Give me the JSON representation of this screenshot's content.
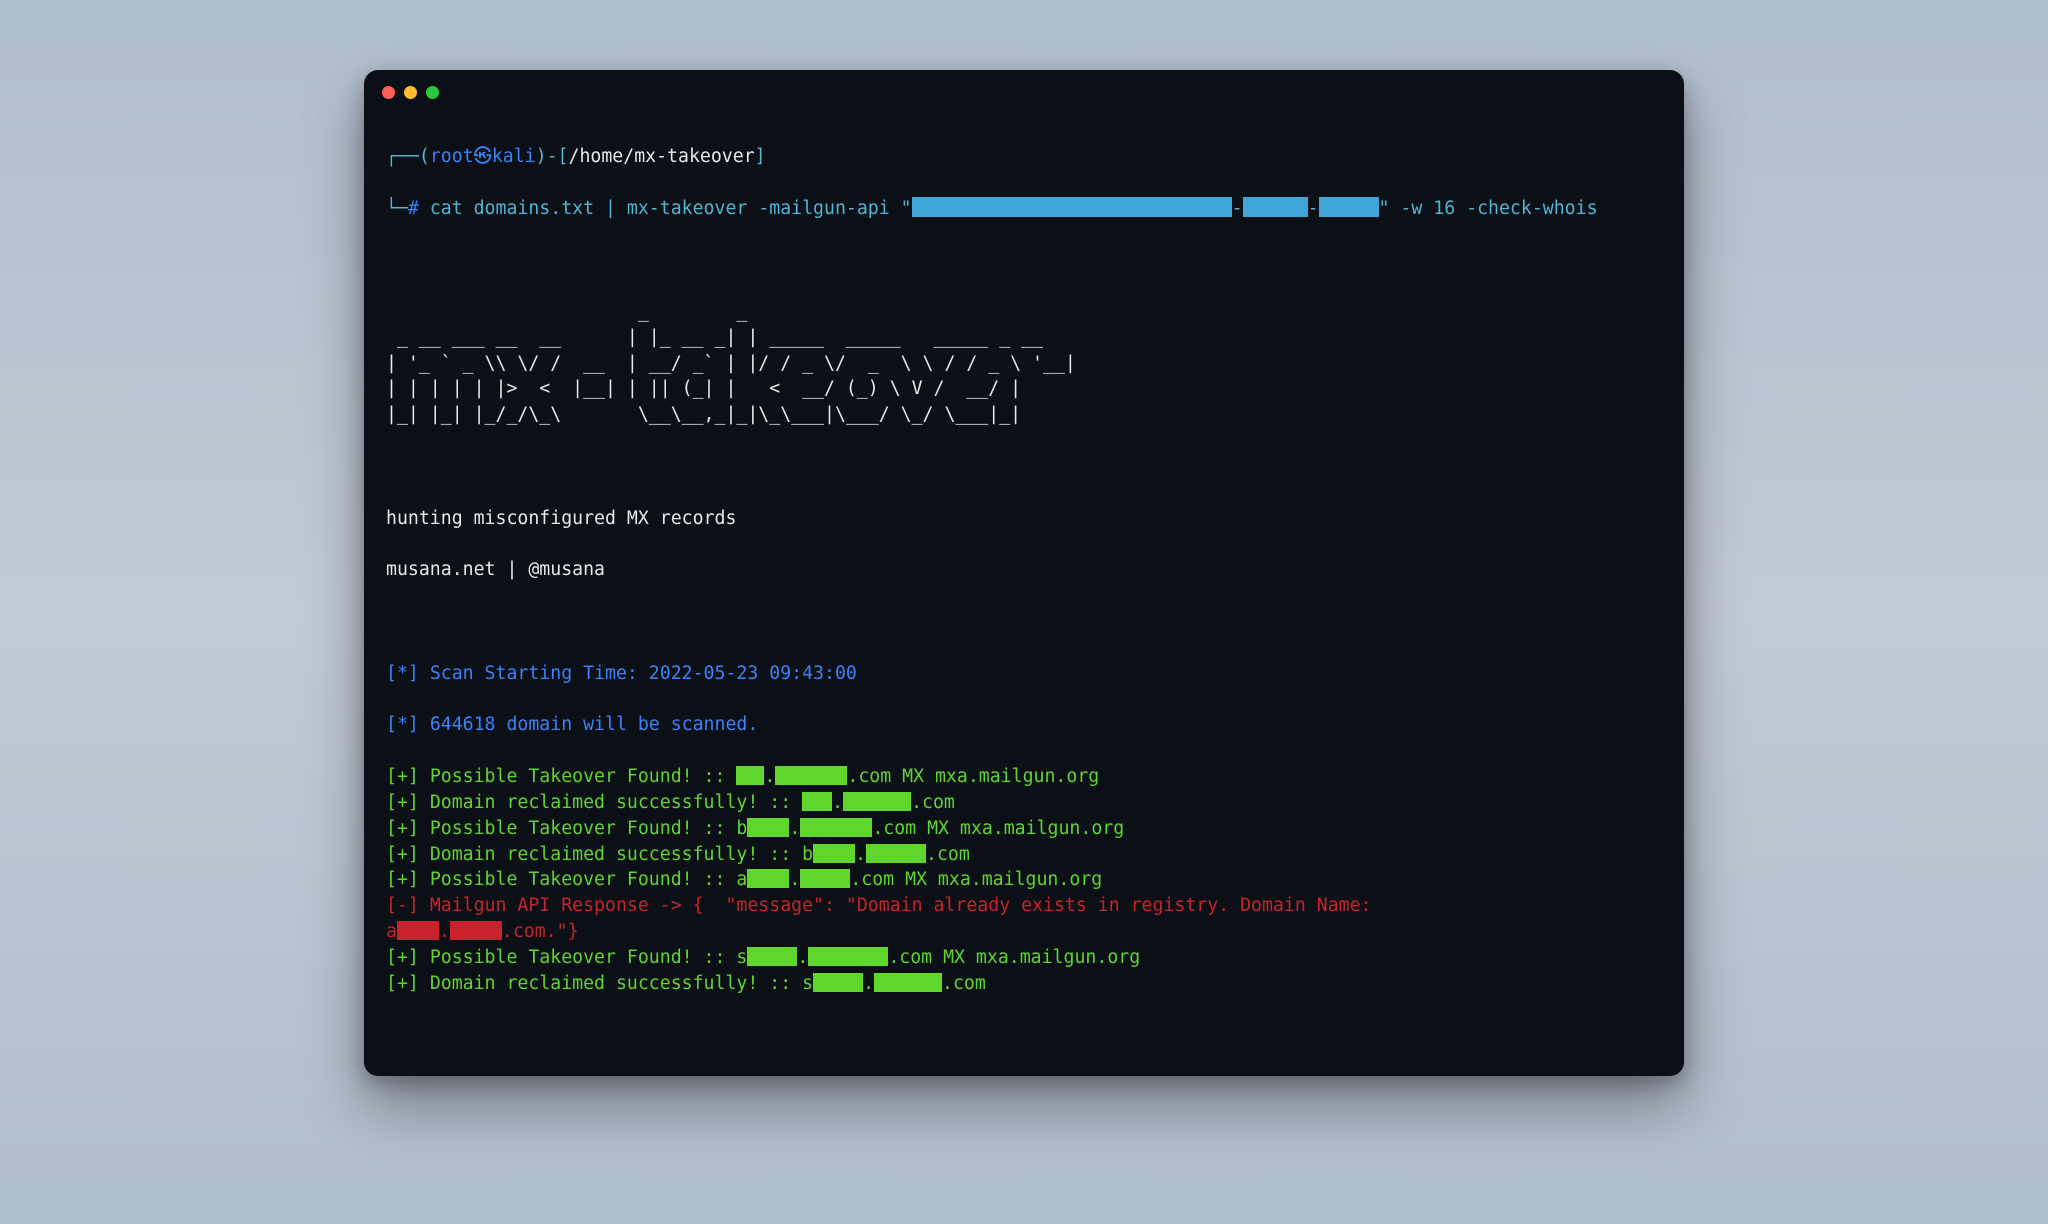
{
  "titlebar": {
    "dots": [
      "red",
      "yellow",
      "green"
    ]
  },
  "prompt": {
    "branch_open": "┌──(",
    "user": "root",
    "at_symbol": "㉿",
    "host": "kali",
    "close_paren": ")-[",
    "cwd": "/home/mx-takeover",
    "bracket_close": "]",
    "line2_prefix": "└─",
    "hash": "# ",
    "cmd_before": "cat domains.txt | mx-takeover -mailgun-api \"",
    "api_seg_widths": [
      320,
      65,
      60
    ],
    "api_dash": "-",
    "cmd_after_quote": "\" ",
    "flag_w": "-w 16 ",
    "flag_whois": "-check-whois"
  },
  "ascii_art": "                       _        _                                \n _ __ ___ __  __      | |_ __ _| | _____  _____   _____ _ __     \n| '_ ` _ \\\\ \\/ /  __  | __/ _` | |/ / _ \\/  _  \\ \\ / / _ \\ '__|  \n| | | | | |>  <  |__| | || (_| |   <  __/ (_) \\ V /  __/ |       \n|_| |_| |_/_/\\_\\       \\__\\__,_|_|\\_\\___|\\___/ \\_/ \\___|_|       ",
  "tagline1": "hunting misconfigured MX records",
  "tagline2": "musana.net | @musana",
  "info1_prefix": "[*] ",
  "info1_text": "Scan Starting Time: 2022-05-23 09:43:00",
  "info2_prefix": "[*] ",
  "info2_text": "644618 domain will be scanned.",
  "results": [
    {
      "type": "found",
      "prefix": "[+] ",
      "label": "Possible Takeover Found! :: ",
      "pre": "",
      "seg": [
        28,
        72
      ],
      "suffix": ".com MX mxa.mailgun.org"
    },
    {
      "type": "ok",
      "prefix": "[+] ",
      "label": "Domain reclaimed successfully! :: ",
      "pre": "",
      "seg": [
        30,
        68
      ],
      "suffix": ".com"
    },
    {
      "type": "found",
      "prefix": "[+] ",
      "label": "Possible Takeover Found! :: ",
      "pre": "b",
      "seg": [
        42,
        72
      ],
      "suffix": ".com MX mxa.mailgun.org"
    },
    {
      "type": "ok",
      "prefix": "[+] ",
      "label": "Domain reclaimed successfully! :: ",
      "pre": "b",
      "seg": [
        42,
        60
      ],
      "suffix": ".com"
    },
    {
      "type": "found",
      "prefix": "[+] ",
      "label": "Possible Takeover Found! :: ",
      "pre": "a",
      "seg": [
        42,
        50
      ],
      "suffix": ".com MX mxa.mailgun.org"
    },
    {
      "type": "err",
      "prefix": "[-] ",
      "text_a": "Mailgun API Response -> {  \"message\": \"Domain already exists in registry. Domain Name: ",
      "text_b_pre": "a",
      "seg": [
        42,
        52
      ],
      "text_c": ".com.\"}"
    },
    {
      "type": "found",
      "prefix": "[+] ",
      "label": "Possible Takeover Found! :: ",
      "pre": "s",
      "seg": [
        50,
        80
      ],
      "suffix": ".com MX mxa.mailgun.org"
    },
    {
      "type": "ok",
      "prefix": "[+] ",
      "label": "Domain reclaimed successfully! :: ",
      "pre": "s",
      "seg": [
        50,
        68
      ],
      "suffix": ".com"
    }
  ]
}
